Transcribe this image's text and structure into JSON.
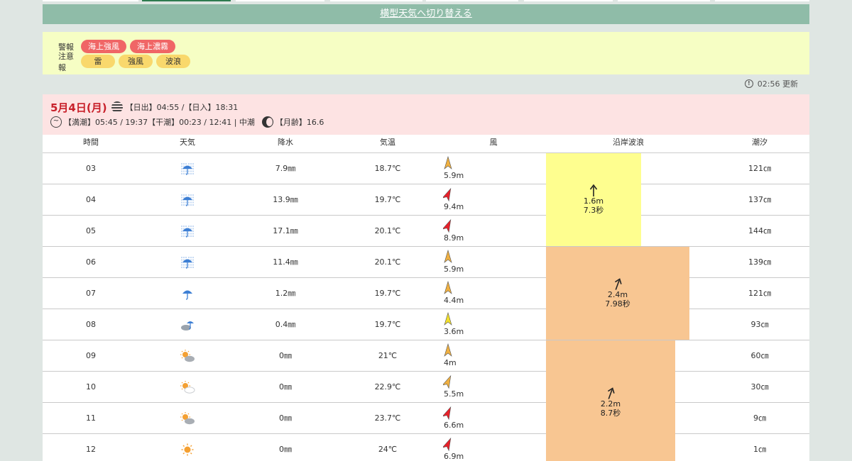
{
  "switch_link": "横型天気へ切り替える",
  "warnings": {
    "keiho_label": "警報",
    "keiho": [
      "海上強風",
      "海上濃霧"
    ],
    "chuiho_label": "注意報",
    "chuiho": [
      "雷",
      "強風",
      "波浪"
    ]
  },
  "updated": "02:56 更新",
  "day": {
    "title": "5月4日(月)",
    "sun": "【日出】04:55 /【日入】18:31",
    "tide": "【満潮】05:45 / 19:37【干潮】00:23 / 12:41 | 中潮",
    "moon": "【月齢】16.6"
  },
  "columns": [
    "時間",
    "天気",
    "降水",
    "気温",
    "風",
    "沿岸波浪",
    "潮汐"
  ],
  "rows": [
    {
      "time": "03",
      "weather": "heavy-rain-icon",
      "rain": "7.9㎜",
      "temp": "18.7℃",
      "wind": "5.9m",
      "wind_color": "#f0b040",
      "wind_dir": "N",
      "tide": "121㎝"
    },
    {
      "time": "04",
      "weather": "heavy-rain-icon",
      "rain": "13.9㎜",
      "temp": "19.7℃",
      "wind": "9.4m",
      "wind_color": "#e8202a",
      "wind_dir": "NE",
      "tide": "137㎝"
    },
    {
      "time": "05",
      "weather": "heavy-rain-icon",
      "rain": "17.1㎜",
      "temp": "20.1℃",
      "wind": "8.9m",
      "wind_color": "#e8202a",
      "wind_dir": "NE",
      "tide": "144㎝"
    },
    {
      "time": "06",
      "weather": "heavy-rain-icon",
      "rain": "11.4㎜",
      "temp": "20.1℃",
      "wind": "5.9m",
      "wind_color": "#f0b040",
      "wind_dir": "N",
      "tide": "139㎝"
    },
    {
      "time": "07",
      "weather": "rain-icon",
      "rain": "1.2㎜",
      "temp": "19.7℃",
      "wind": "4.4m",
      "wind_color": "#f0b040",
      "wind_dir": "N",
      "tide": "121㎝"
    },
    {
      "time": "08",
      "weather": "cloud-rain-icon",
      "rain": "0.4㎜",
      "temp": "19.7℃",
      "wind": "3.6m",
      "wind_color": "#f3e02a",
      "wind_dir": "N",
      "tide": "93㎝"
    },
    {
      "time": "09",
      "weather": "sun-cloud-icon",
      "rain": "0㎜",
      "temp": "21℃",
      "wind": "4m",
      "wind_color": "#f0b040",
      "wind_dir": "N",
      "tide": "60㎝"
    },
    {
      "time": "10",
      "weather": "sun-cloud-light-icon",
      "rain": "0㎜",
      "temp": "22.9℃",
      "wind": "5.5m",
      "wind_color": "#f0b040",
      "wind_dir": "NE",
      "tide": "30㎝"
    },
    {
      "time": "11",
      "weather": "sun-cloud-icon",
      "rain": "0㎜",
      "temp": "23.7℃",
      "wind": "6.6m",
      "wind_color": "#e8202a",
      "wind_dir": "NE",
      "tide": "9㎝"
    },
    {
      "time": "12",
      "weather": "sun-icon",
      "rain": "0㎜",
      "temp": "24℃",
      "wind": "6.9m",
      "wind_color": "#e8202a",
      "wind_dir": "NE",
      "tide": "1㎝"
    }
  ],
  "waves": [
    {
      "height": "1.6m",
      "period": "7.3秒",
      "color": "#fefe8f",
      "rows": [
        0,
        2
      ],
      "level": 0.28
    },
    {
      "height": "2.4m",
      "period": "7.98秒",
      "color": "#f8c692",
      "rows": [
        3,
        5
      ],
      "level": 0.42
    },
    {
      "height": "2.2m",
      "period": "8.7秒",
      "color": "#f8c692",
      "rows": [
        6,
        9
      ],
      "level": 0.38
    }
  ]
}
